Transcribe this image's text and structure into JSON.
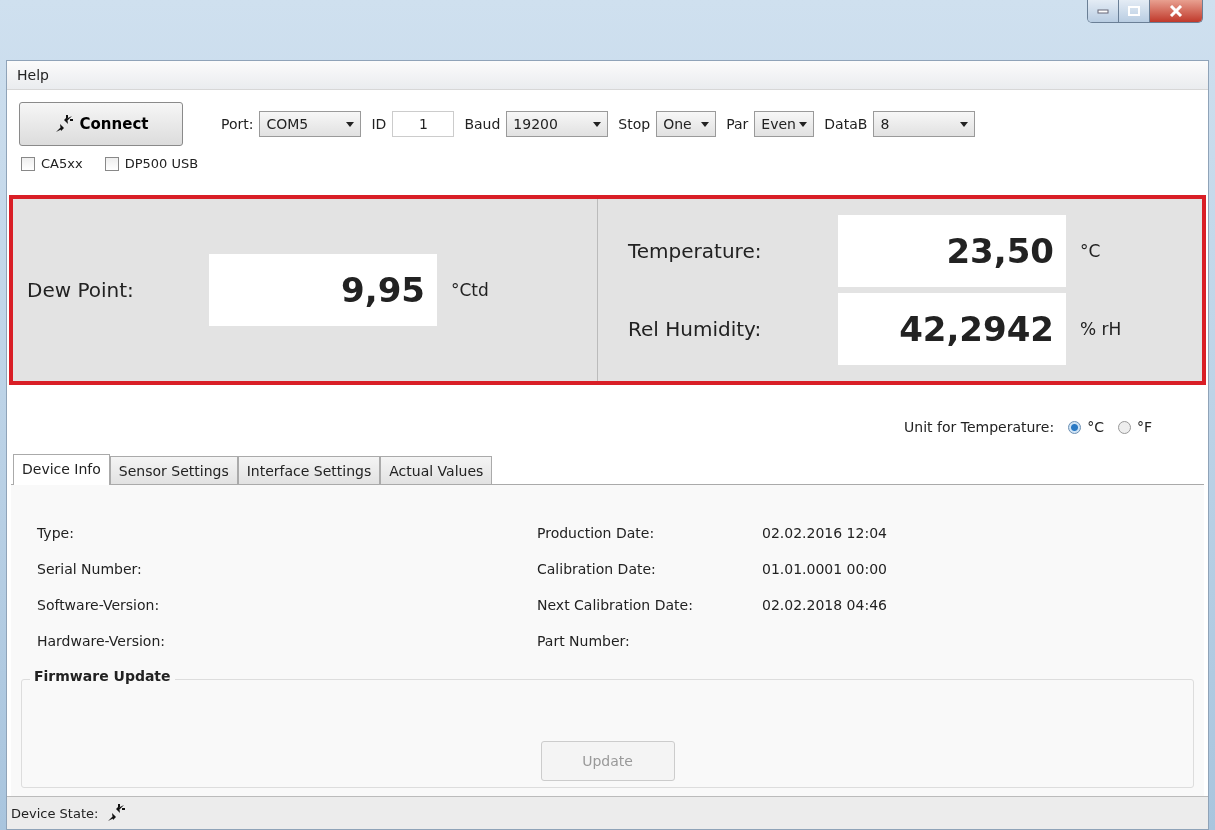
{
  "menu": [
    "Help"
  ],
  "toolbar": {
    "connect": "Connect",
    "fields": [
      {
        "kind": "select",
        "label": "Port:",
        "value": "COM5"
      },
      {
        "kind": "text",
        "label": "ID",
        "value": "1"
      },
      {
        "kind": "select",
        "label": "Baud",
        "value": "19200"
      },
      {
        "kind": "select",
        "label": "Stop",
        "value": "One"
      },
      {
        "kind": "select",
        "label": "Par",
        "value": "Even"
      },
      {
        "kind": "select",
        "label": "DataB",
        "value": "8"
      }
    ]
  },
  "options": [
    {
      "label": "CA5xx",
      "checked": false
    },
    {
      "label": "DP500 USB",
      "checked": false
    }
  ],
  "readings": {
    "dew_point": {
      "label": "Dew Point:",
      "value": "9,95",
      "unit": "°Ctd"
    },
    "right": [
      {
        "label": "Temperature:",
        "value": "23,50",
        "unit": "°C"
      },
      {
        "label": "Rel Humidity:",
        "value": "42,2942",
        "unit": "% rH"
      }
    ]
  },
  "unit_for_temperature": {
    "label": "Unit for Temperature:",
    "options": [
      {
        "label": "°C",
        "selected": true
      },
      {
        "label": "°F",
        "selected": false
      }
    ]
  },
  "tabs": [
    {
      "label": "Device Info",
      "selected": true
    },
    {
      "label": "Sensor Settings",
      "selected": false
    },
    {
      "label": "Interface Settings",
      "selected": false
    },
    {
      "label": "Actual Values",
      "selected": false
    }
  ],
  "device_info": {
    "left": [
      {
        "label": "Type:"
      },
      {
        "label": "Serial Number:"
      },
      {
        "label": "Software-Version:"
      },
      {
        "label": "Hardware-Version:"
      }
    ],
    "right": [
      {
        "label": "Production Date:",
        "value": "02.02.2016 12:04"
      },
      {
        "label": "Calibration Date:",
        "value": "01.01.0001 00:00"
      },
      {
        "label": "Next Calibration Date:",
        "value": "02.02.2018 04:46"
      },
      {
        "label": "Part Number:"
      }
    ]
  },
  "firmware_update": {
    "title": "Firmware Update",
    "button": "Update",
    "disabled": true
  },
  "status_bar": {
    "label": "Device State:"
  }
}
